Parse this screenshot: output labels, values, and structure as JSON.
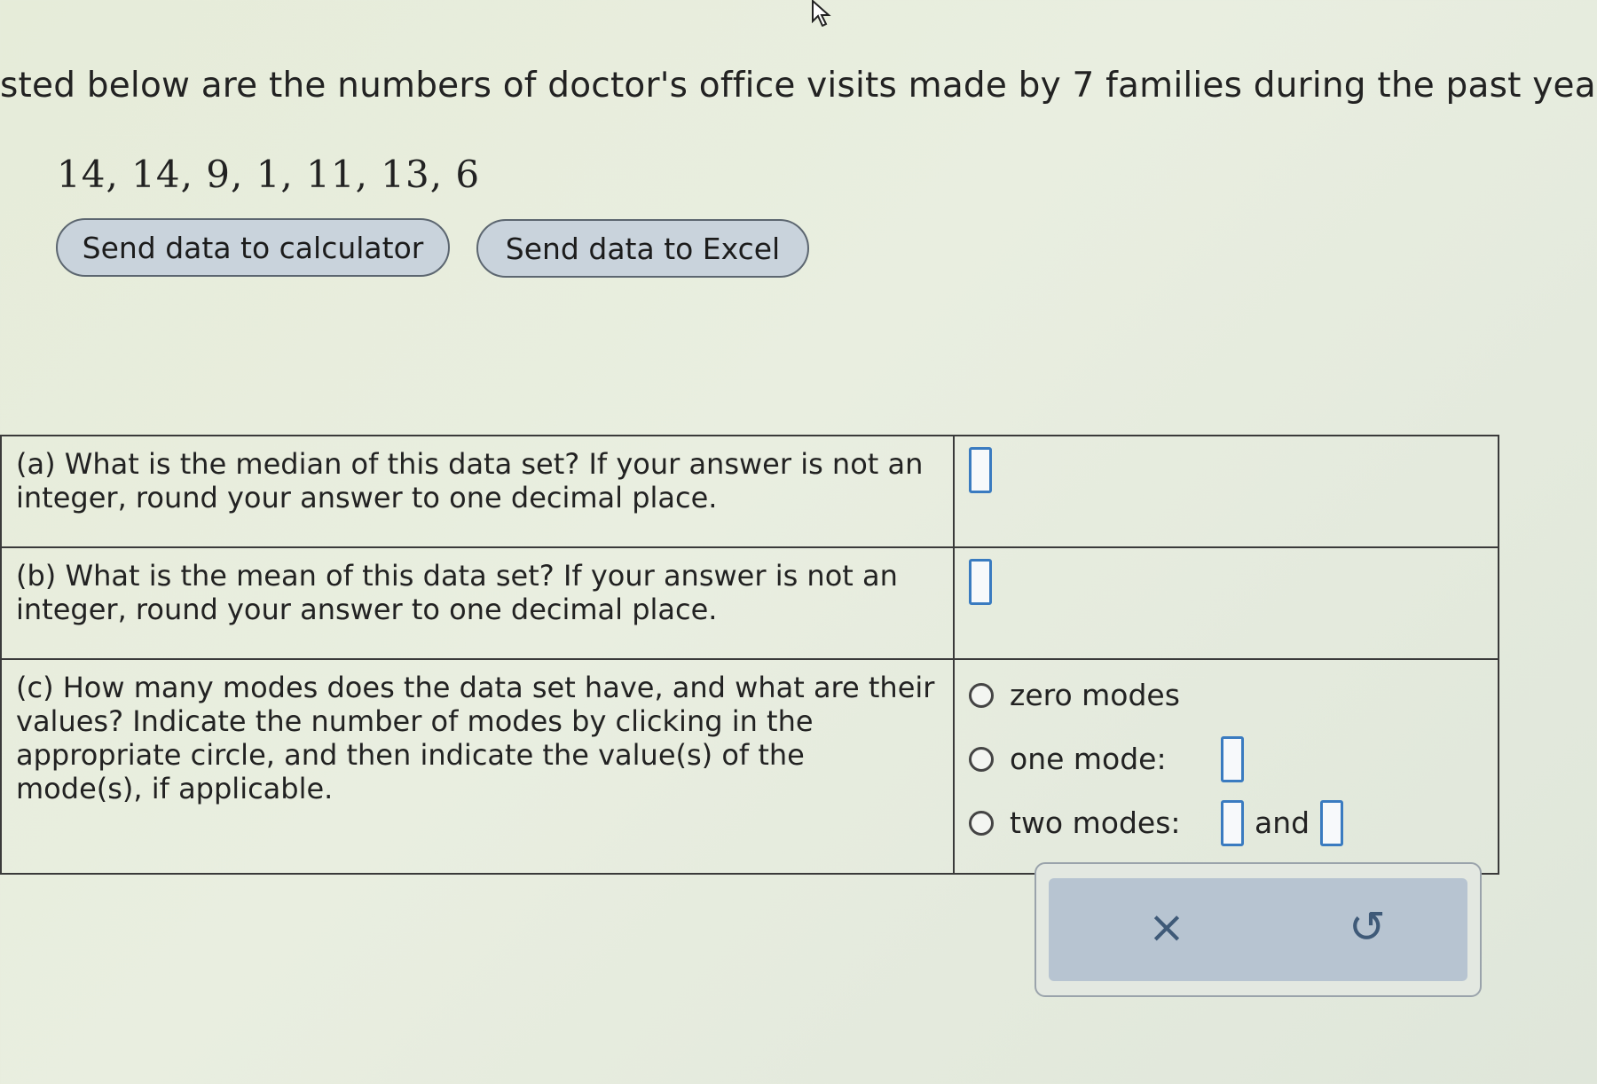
{
  "intro": "sted below are the numbers of doctor's office visits made by 7 families during the past year.",
  "data_values": "14, 14, 9, 1, 11, 13, 6",
  "buttons": {
    "calculator": "Send data to calculator",
    "excel": "Send data to Excel"
  },
  "questions": {
    "a": "(a) What is the median of this data set? If your answer is not an integer, round your answer to one decimal place.",
    "b": "(b) What is the mean of this data set? If your answer is not an integer, round your answer to one decimal place.",
    "c": "(c) How many modes does the data set have, and what are their values? Indicate the number of modes by clicking in the appropriate circle, and then indicate the value(s) of the mode(s), if applicable."
  },
  "mode_options": {
    "zero": "zero modes",
    "one": "one mode:",
    "two": "two modes:",
    "and": "and"
  },
  "controls": {
    "clear": "×",
    "undo": "↺"
  },
  "icons": {
    "cursor": "mouse-pointer-icon",
    "clear": "close-icon",
    "undo": "undo-icon"
  },
  "colors": {
    "input_border": "#3a7bc0",
    "button_fill": "#c9d3dc",
    "panel_fill": "#b7c4d1"
  }
}
